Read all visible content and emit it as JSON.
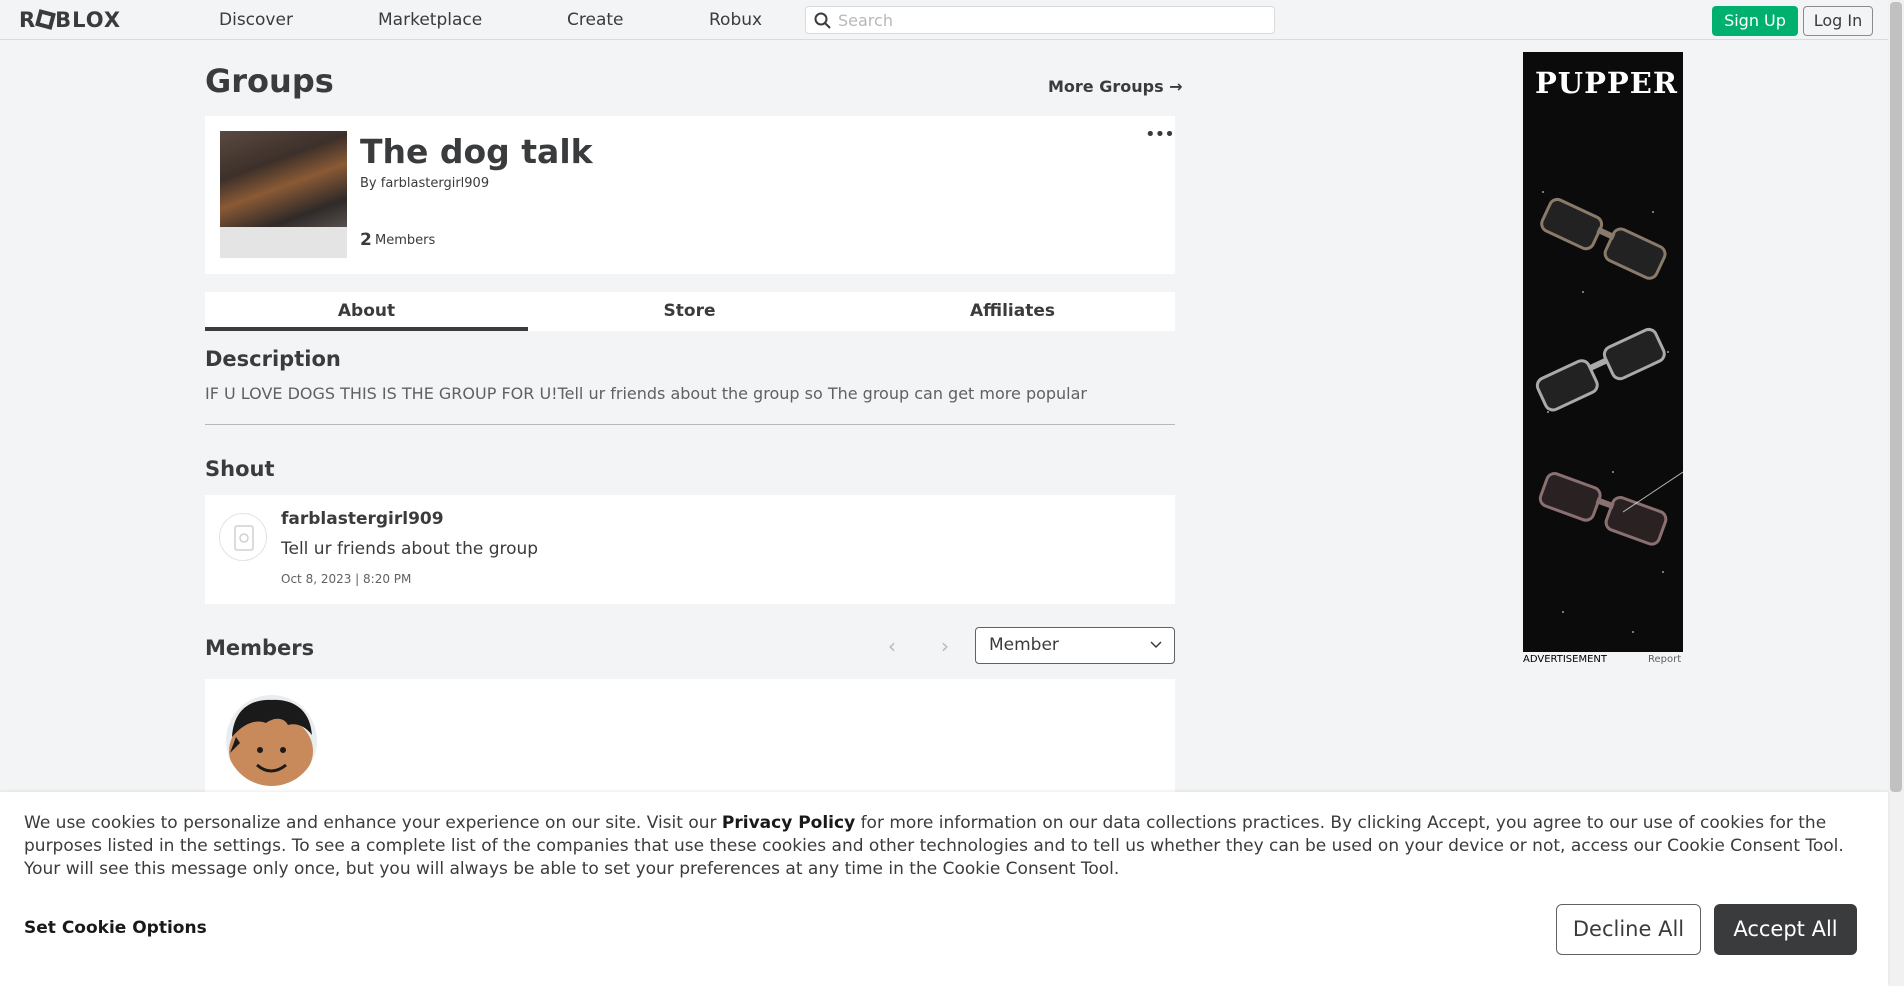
{
  "header": {
    "logo": "ROBLOX",
    "nav": [
      "Discover",
      "Marketplace",
      "Create",
      "Robux"
    ],
    "search_placeholder": "Search",
    "signup_label": "Sign Up",
    "login_label": "Log In"
  },
  "page": {
    "title": "Groups",
    "more_groups": "More Groups →"
  },
  "group": {
    "name": "The dog talk",
    "by_prefix": "By",
    "owner": "farblastergirl909",
    "member_count": "2",
    "member_label": "Members",
    "menu_icon": "more-dots-icon"
  },
  "tabs": [
    "About",
    "Store",
    "Affiliates"
  ],
  "description": {
    "title": "Description",
    "text": "IF U LOVE DOGS THIS IS THE GROUP FOR U!Tell ur friends about the group so The group can get more popular"
  },
  "shout": {
    "title": "Shout",
    "user": "farblastergirl909",
    "text": "Tell ur friends about the group",
    "date": "Oct 8, 2023 | 8:20 PM"
  },
  "members": {
    "title": "Members",
    "role_selected": "Member"
  },
  "ad": {
    "brand": "PUPPER",
    "label": "ADVERTISEMENT",
    "report": "Report"
  },
  "cookie": {
    "text_before": "We use cookies to personalize and enhance your experience on our site. Visit our ",
    "privacy_link": "Privacy Policy",
    "text_after": " for more information on our data collections practices. By clicking Accept, you agree to our use of cookies for the purposes listed in the settings. To see a complete list of the companies that use these cookies and other technologies and to tell us whether they can be used on your device or not, access our Cookie Consent Tool. Your will see this message only once, but you will always be able to set your preferences at any time in the Cookie Consent Tool.",
    "options_label": "Set Cookie Options",
    "decline_label": "Decline All",
    "accept_label": "Accept All"
  },
  "colors": {
    "accent_green": "#00b06f",
    "text_dark": "#393b3d",
    "page_bg": "#f2f4f5"
  }
}
